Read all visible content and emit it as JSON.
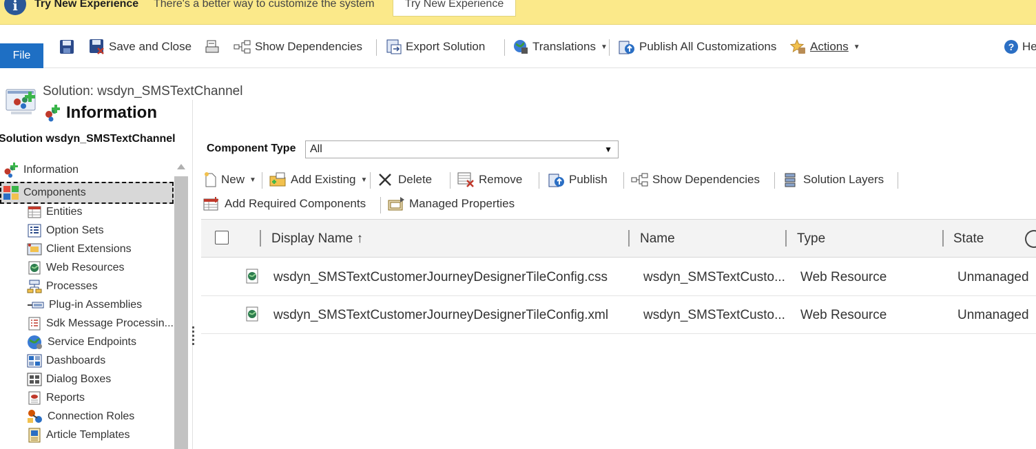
{
  "notification": {
    "title": "Try New Experience",
    "message": "There's a better way to customize the system",
    "button_label": "Try New Experience"
  },
  "ribbon": {
    "file_label": "File",
    "save_and_close": "Save and Close",
    "show_dependencies": "Show Dependencies",
    "export_solution": "Export Solution",
    "translations": "Translations",
    "publish_all": "Publish All Customizations",
    "actions": "Actions",
    "help": "Hel"
  },
  "header": {
    "solution_label": "Solution: wsdyn_SMSTextChannel",
    "page_title": "Information"
  },
  "nav": {
    "heading": "Solution wsdyn_SMSTextChannel",
    "items": [
      {
        "label": "Information",
        "icon": "information-icon"
      },
      {
        "label": "Components",
        "icon": "components-icon"
      },
      {
        "label": "Entities",
        "icon": "entities-icon"
      },
      {
        "label": "Option Sets",
        "icon": "option-sets-icon"
      },
      {
        "label": "Client Extensions",
        "icon": "client-extensions-icon"
      },
      {
        "label": "Web Resources",
        "icon": "web-resources-icon"
      },
      {
        "label": "Processes",
        "icon": "processes-icon"
      },
      {
        "label": "Plug-in Assemblies",
        "icon": "plugin-assemblies-icon"
      },
      {
        "label": "Sdk Message Processin...",
        "icon": "sdk-message-icon"
      },
      {
        "label": "Service Endpoints",
        "icon": "service-endpoints-icon"
      },
      {
        "label": "Dashboards",
        "icon": "dashboards-icon"
      },
      {
        "label": "Dialog Boxes",
        "icon": "dialog-boxes-icon"
      },
      {
        "label": "Reports",
        "icon": "reports-icon"
      },
      {
        "label": "Connection Roles",
        "icon": "connection-roles-icon"
      },
      {
        "label": "Article Templates",
        "icon": "article-templates-icon"
      }
    ]
  },
  "filter": {
    "label": "Component Type",
    "value": "All"
  },
  "grid_toolbar": {
    "new": "New",
    "add_existing": "Add Existing",
    "delete": "Delete",
    "remove": "Remove",
    "publish": "Publish",
    "show_dependencies": "Show Dependencies",
    "solution_layers": "Solution Layers",
    "add_required": "Add Required Components",
    "managed_properties": "Managed Properties"
  },
  "grid": {
    "columns": [
      "Display Name ↑",
      "Name",
      "Type",
      "State"
    ],
    "rows": [
      {
        "display_name": "wsdyn_SMSTextCustomerJourneyDesignerTileConfig.css",
        "name": "wsdyn_SMSTextCusto...",
        "type": "Web Resource",
        "state": "Unmanaged"
      },
      {
        "display_name": "wsdyn_SMSTextCustomerJourneyDesignerTileConfig.xml",
        "name": "wsdyn_SMSTextCusto...",
        "type": "Web Resource",
        "state": "Unmanaged"
      }
    ]
  },
  "colors": {
    "notification_bg": "#fbe98a",
    "file_button": "#1e6fc4",
    "selected_nav": "#d8d8d8"
  }
}
